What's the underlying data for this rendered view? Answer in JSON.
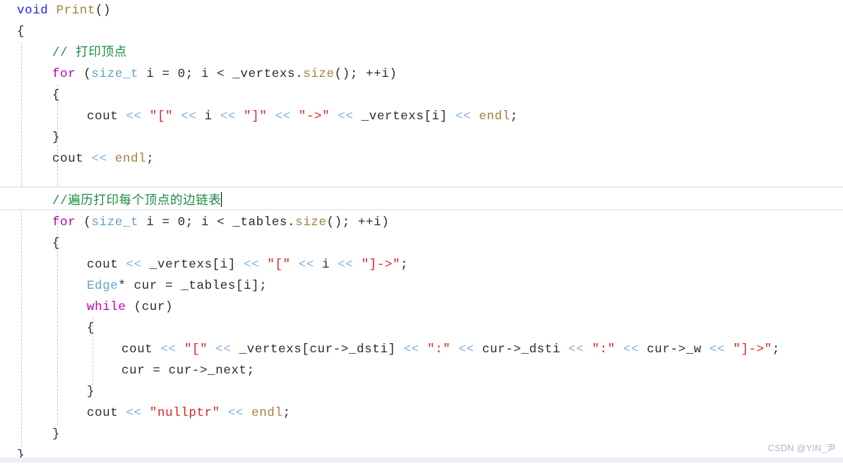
{
  "editor": {
    "language": "C++",
    "background_color": "#ffffff",
    "current_line_index": 7,
    "caret_visible": true,
    "indent_guide_color": "#c8c8c8",
    "current_line_border_color": "#e8eaf2",
    "bottom_bar_color": "#eceef5"
  },
  "watermark": {
    "text": "CSDN @YIN_尹",
    "color": "#b4b4b4"
  },
  "colors": {
    "keyword": "#bb00bb",
    "keyword_void": "#2424e0",
    "type": "#64a0c8",
    "function": "#a08040",
    "string": "#dd2222",
    "string_inner": "#8b1a1a",
    "stream_operator": "#82aedd",
    "comment": "#1d8a43",
    "plain": "#1f1f1f",
    "index_var": "#4a6fb5"
  },
  "code": {
    "full_text": "void Print()\n{\n    // 打印顶点\n    for (size_t i = 0; i < _vertexs.size(); ++i)\n    {\n        cout << \"[\" << i << \"]\" << \"->\" << _vertexs[i] << endl;\n    }\n    cout << endl;\n\n    //遍历打印每个顶点的边链表\n    for (size_t i = 0; i < _tables.size(); ++i)\n    {\n        cout << _vertexs[i] << \"[\" << i << \"]->\";\n        Edge* cur = _tables[i];\n        while (cur)\n        {\n            cout << \"[\" << _vertexs[cur->_dsti] << \":\" << cur->_dsti << \":\" << cur->_w << \"]->\";\n            cur = cur->_next;\n        }\n        cout << \"nullptr\" << endl;\n    }\n}",
    "lines": [
      {
        "n": 1,
        "indent": 0,
        "text": "void Print()"
      },
      {
        "n": 2,
        "indent": 0,
        "text": "{"
      },
      {
        "n": 3,
        "indent": 1,
        "text": "// 打印顶点"
      },
      {
        "n": 4,
        "indent": 1,
        "text": "for (size_t i = 0; i < _vertexs.size(); ++i)"
      },
      {
        "n": 5,
        "indent": 1,
        "text": "{"
      },
      {
        "n": 6,
        "indent": 2,
        "text": "cout << \"[\" << i << \"]\" << \"->\" << _vertexs[i] << endl;"
      },
      {
        "n": 7,
        "indent": 1,
        "text": "}"
      },
      {
        "n": 8,
        "indent": 1,
        "text": "cout << endl;"
      },
      {
        "n": 9,
        "indent": 0,
        "text": ""
      },
      {
        "n": 10,
        "indent": 1,
        "text": "//遍历打印每个顶点的边链表"
      },
      {
        "n": 11,
        "indent": 1,
        "text": "for (size_t i = 0; i < _tables.size(); ++i)"
      },
      {
        "n": 12,
        "indent": 1,
        "text": "{"
      },
      {
        "n": 13,
        "indent": 2,
        "text": "cout << _vertexs[i] << \"[\" << i << \"]->\";"
      },
      {
        "n": 14,
        "indent": 2,
        "text": "Edge* cur = _tables[i];"
      },
      {
        "n": 15,
        "indent": 2,
        "text": "while (cur)"
      },
      {
        "n": 16,
        "indent": 2,
        "text": "{"
      },
      {
        "n": 17,
        "indent": 3,
        "text": "cout << \"[\" << _vertexs[cur->_dsti] << \":\" << cur->_dsti << \":\" << cur->_w << \"]->\";"
      },
      {
        "n": 18,
        "indent": 3,
        "text": "cur = cur->_next;"
      },
      {
        "n": 19,
        "indent": 2,
        "text": "}"
      },
      {
        "n": 20,
        "indent": 2,
        "text": "cout << \"nullptr\" << endl;"
      },
      {
        "n": 21,
        "indent": 1,
        "text": "}"
      },
      {
        "n": 22,
        "indent": 0,
        "text": "}"
      }
    ]
  },
  "tokens": {
    "l1": {
      "kw": "void",
      "fn": "Print",
      "punct": "()"
    },
    "l2": "{",
    "l3": "// 打印顶点",
    "l4": {
      "kw": "for",
      "type": "size_t",
      "fn": "size",
      "rest": " (",
      "i": "i",
      "eq": " = ",
      "zero": "0",
      "semi": "; ",
      "lt": " < ",
      "obj": "_vertexs",
      "dot": ".",
      "call": "(); ",
      "inc": "++i",
      "close": ")"
    },
    "l6": {
      "cout": "cout",
      "s1": "\"[\"",
      "s2": "\"]\"",
      "s3": "\"->\"",
      "expr": "_vertexs[i]",
      "endl": "endl"
    },
    "l8": {
      "cout": "cout",
      "endl": "endl"
    },
    "l10": "//遍历打印每个顶点的边链表",
    "l11": {
      "kw": "for",
      "type": "size_t",
      "obj": "_tables",
      "fn": "size"
    },
    "l13": {
      "cout": "cout",
      "expr": "_vertexs[i]",
      "s1": "\"[\"",
      "i": "i",
      "s2": "\"]->\""
    },
    "l14": {
      "type": "Edge",
      "star": "*",
      "var": "cur",
      "expr": "_tables[i]"
    },
    "l15": {
      "kw": "while",
      "cond": "(cur)"
    },
    "l17": {
      "cout": "cout",
      "s1": "\"[\"",
      "e1": "_vertexs[cur->_dsti]",
      "s2": "\":\"",
      "e2": "cur->_dsti",
      "s3": "\":\"",
      "e3": "cur->_w",
      "s4": "\"]->\""
    },
    "l18": {
      "lhs": "cur",
      "rhs": "cur->_next"
    },
    "l20": {
      "cout": "cout",
      "str": "\"nullptr\"",
      "endl": "endl"
    },
    "stream_op": "<<"
  }
}
